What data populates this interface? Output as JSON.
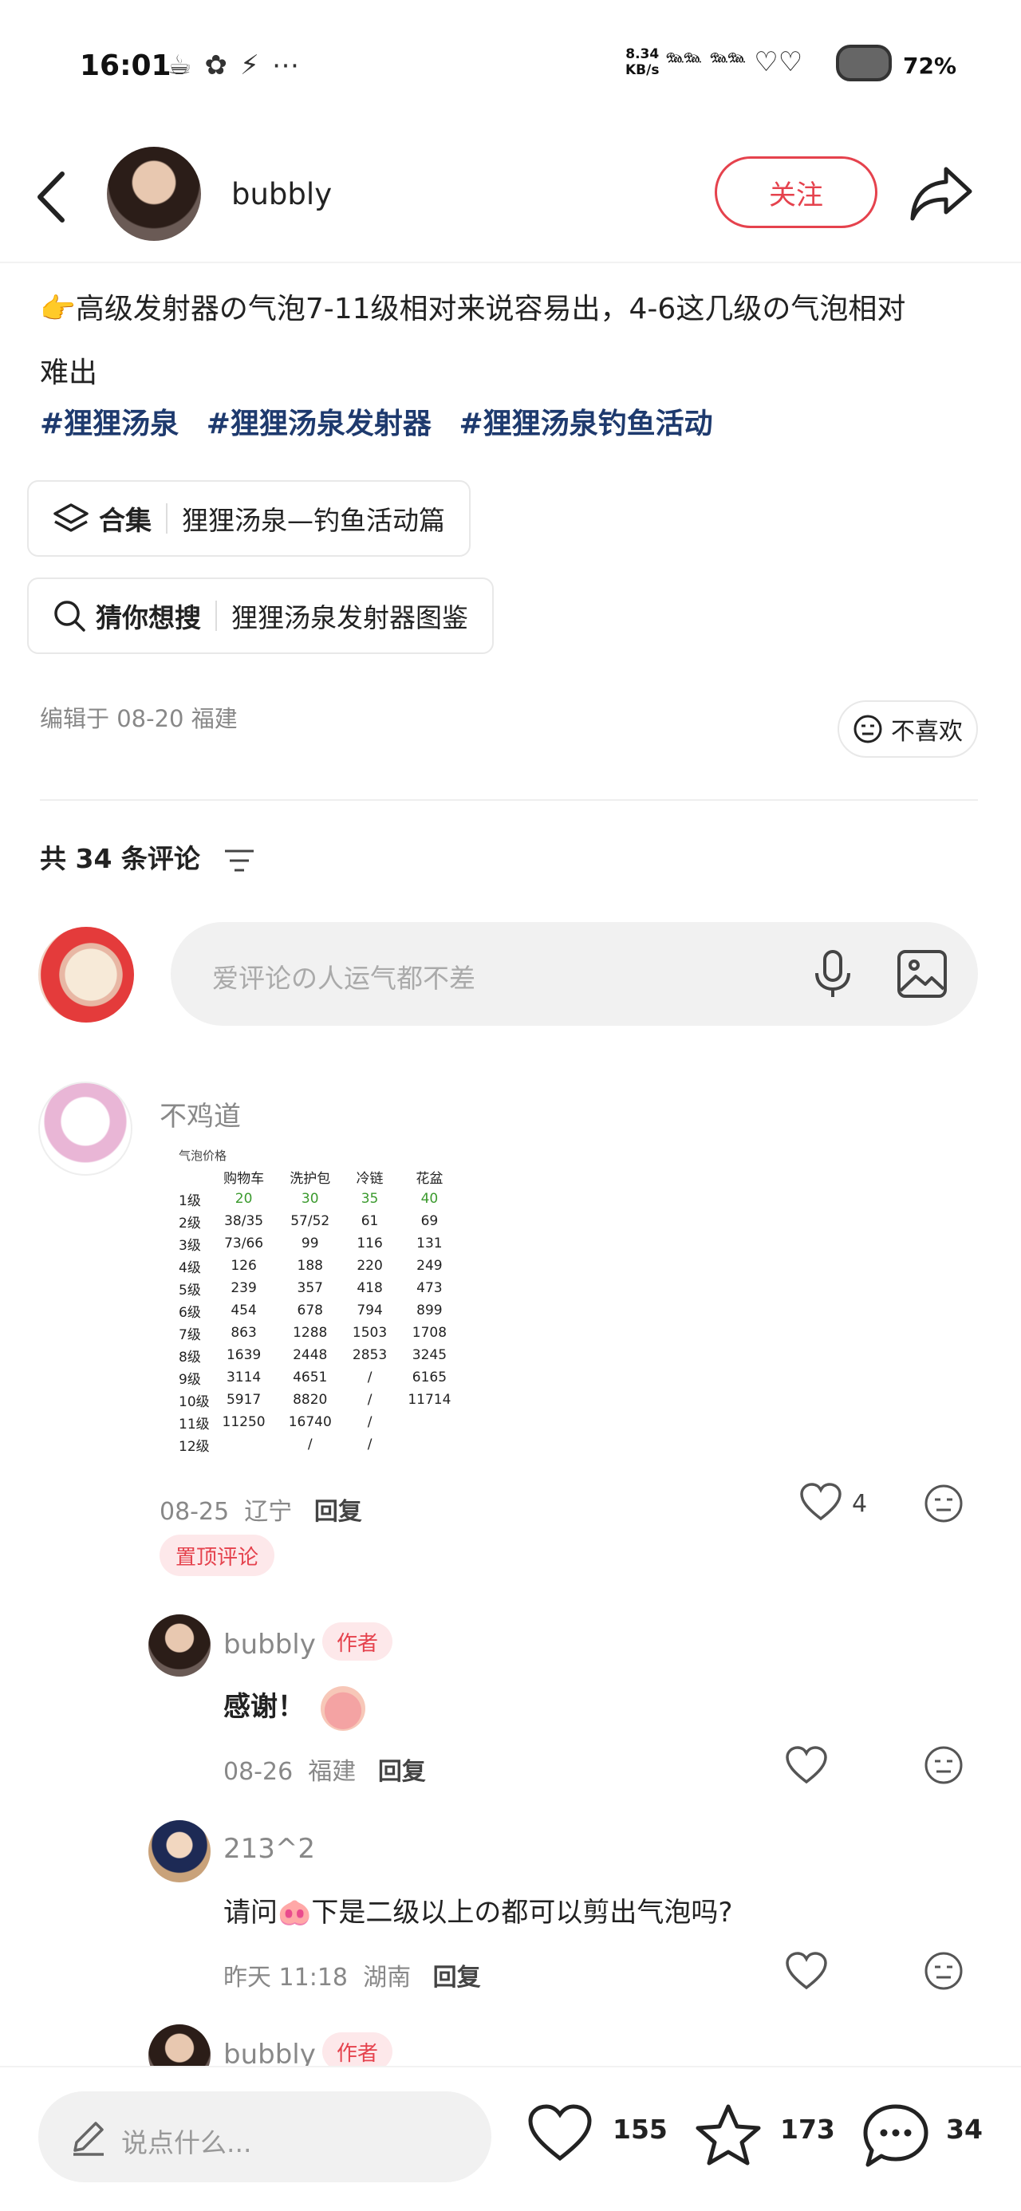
{
  "status_bar": {
    "time": "16:01",
    "net_rate_value": "8.34",
    "net_rate_unit": "KB/s",
    "battery": "72%"
  },
  "header": {
    "author": "bubbly",
    "follow_label": "关注"
  },
  "post": {
    "desc_line1": "👉高级发射器の气泡7-11级相对来说容易出，4-6这几级の气泡相对",
    "desc_line2": "难出",
    "tags": [
      "#狸狸汤泉",
      "#狸狸汤泉发射器",
      "#狸狸汤泉钓鱼活动"
    ],
    "collection_label": "合集",
    "collection_value": "狸狸汤泉—钓鱼活动篇",
    "search_label": "猜你想搜",
    "search_value": "狸狸汤泉发射器图鉴",
    "edited": "编辑于 08-20 福建",
    "dislike_label": "不喜欢"
  },
  "comments_header": {
    "count_text": "共 34 条评论",
    "input_placeholder": "爱评论の人运气都不差"
  },
  "comments": [
    {
      "name": "不鸡道",
      "meta_date": "08-25",
      "meta_loc": "辽宁",
      "reply": "回复",
      "likes": "4",
      "pinned_label": "置顶评论",
      "table": {
        "title": "气泡价格",
        "headers": [
          "",
          "购物车",
          "洗护包",
          "冷链",
          "花盆"
        ],
        "rows": [
          [
            "1级",
            "20",
            "30",
            "35",
            "40"
          ],
          [
            "2级",
            "38/35",
            "57/52",
            "61",
            "69"
          ],
          [
            "3级",
            "73/66",
            "99",
            "116",
            "131"
          ],
          [
            "4级",
            "126",
            "188",
            "220",
            "249"
          ],
          [
            "5级",
            "239",
            "357",
            "418",
            "473"
          ],
          [
            "6级",
            "454",
            "678",
            "794",
            "899"
          ],
          [
            "7级",
            "863",
            "1288",
            "1503",
            "1708"
          ],
          [
            "8级",
            "1639",
            "2448",
            "2853",
            "3245"
          ],
          [
            "9级",
            "3114",
            "4651",
            "/",
            "6165"
          ],
          [
            "10级",
            "5917",
            "8820",
            "/",
            "11714"
          ],
          [
            "11级",
            "11250",
            "16740",
            "/",
            ""
          ],
          [
            "12级",
            "",
            "/",
            "/",
            ""
          ]
        ]
      }
    },
    {
      "name": "bubbly",
      "badge": "作者",
      "text": "感谢！",
      "meta_date": "08-26",
      "meta_loc": "福建",
      "reply": "回复"
    },
    {
      "name": "213^2",
      "text": "请问🐽下是二级以上の都可以剪出气泡吗?",
      "meta_date": "昨天 11:18",
      "meta_loc": "湖南",
      "reply": "回复"
    },
    {
      "name": "bubbly",
      "badge": "作者"
    }
  ],
  "bottom_bar": {
    "say_placeholder": "说点什么...",
    "likes": "155",
    "stars": "173",
    "comments": "34"
  }
}
